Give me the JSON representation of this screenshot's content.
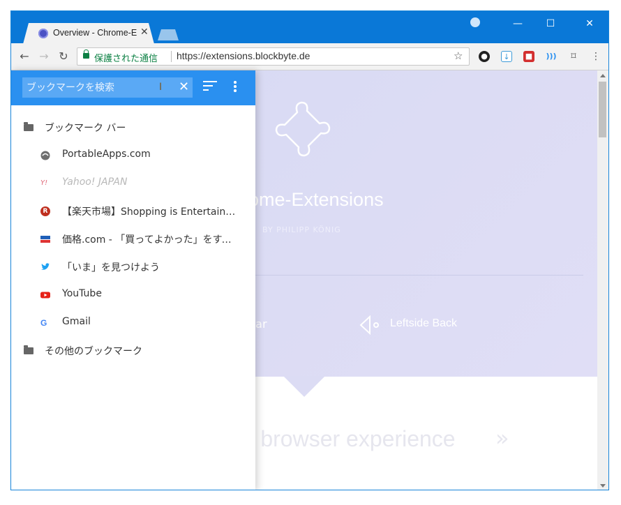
{
  "tab": {
    "title": "Overview - Chrome-Ex"
  },
  "window_controls": {
    "minimize": "—",
    "maximize": "☐",
    "close": "✕"
  },
  "omnibox": {
    "secure_label": "保護された通信",
    "url": "https://extensions.blockbyte.de"
  },
  "hero": {
    "title": "ome-Extensions",
    "byline": "BY PHILIPP KÖNIG",
    "left_label": "bar",
    "right_label": "Leftside Back"
  },
  "tagline": {
    "text": "ur browser experience",
    "arrow": "»"
  },
  "bookmarks_panel": {
    "search_placeholder": "ブックマークを検索",
    "items": [
      {
        "type": "folder",
        "label": "ブックマーク バー",
        "icon": "folder-icon"
      },
      {
        "type": "link",
        "label": "PortableApps.com",
        "icon": "portableapps-icon"
      },
      {
        "type": "link",
        "label": "Yahoo! JAPAN",
        "icon": "yahoo-icon"
      },
      {
        "type": "link",
        "label": "【楽天市場】Shopping is Entertainment! ：",
        "icon": "rakuten-icon"
      },
      {
        "type": "link",
        "label": "価格.com - 「買ってよかった」をすべての人に。",
        "icon": "kakaku-icon"
      },
      {
        "type": "link",
        "label": "「いま」を見つけよう",
        "icon": "twitter-icon"
      },
      {
        "type": "link",
        "label": "YouTube",
        "icon": "youtube-icon"
      },
      {
        "type": "link",
        "label": "Gmail",
        "icon": "google-icon"
      },
      {
        "type": "folder",
        "label": "その他のブックマーク",
        "icon": "folder-icon"
      }
    ]
  },
  "colors": {
    "titlebar": "#0a78d7",
    "panel_header": "#2a90f0",
    "secure_green": "#0b8043"
  }
}
